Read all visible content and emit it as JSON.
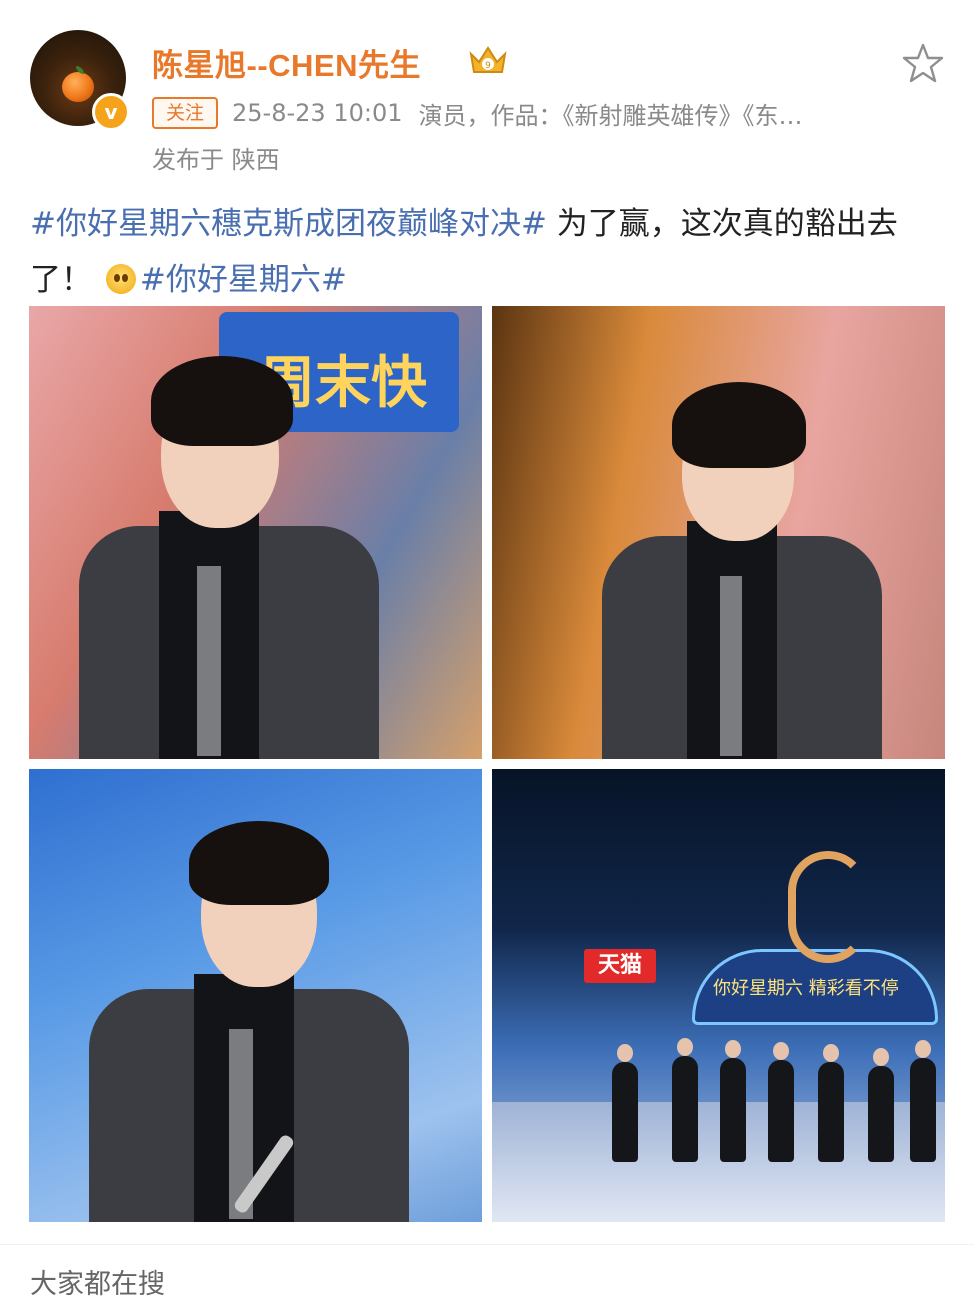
{
  "post": {
    "username": "陈星旭--CHEN先生",
    "follow_label": "关注",
    "timestamp": "25-8-23 10:01",
    "bio": "演员，作品：《新射雕英雄传》《东…",
    "location": "发布于 陕西",
    "text": {
      "tag1": "#你好星期六穗克斯成团夜巅峰对决#",
      "body": " 为了赢，这次真的豁出去了！",
      "tag2": "#你好星期六#"
    }
  },
  "photos": {
    "p1_sign": "周末快",
    "p4_tmall": "天猫",
    "p4_banner": "你好星期六 精彩看不停"
  },
  "footer": {
    "trending_label": "大家都在搜"
  },
  "colors": {
    "username": "#e8782a",
    "hashtag": "#4a6fb0",
    "meta": "#8a8a8a"
  },
  "icons": [
    "avatar",
    "verified-badge-icon",
    "crown-badge-icon",
    "star-favorite-icon",
    "emoji-icon"
  ]
}
